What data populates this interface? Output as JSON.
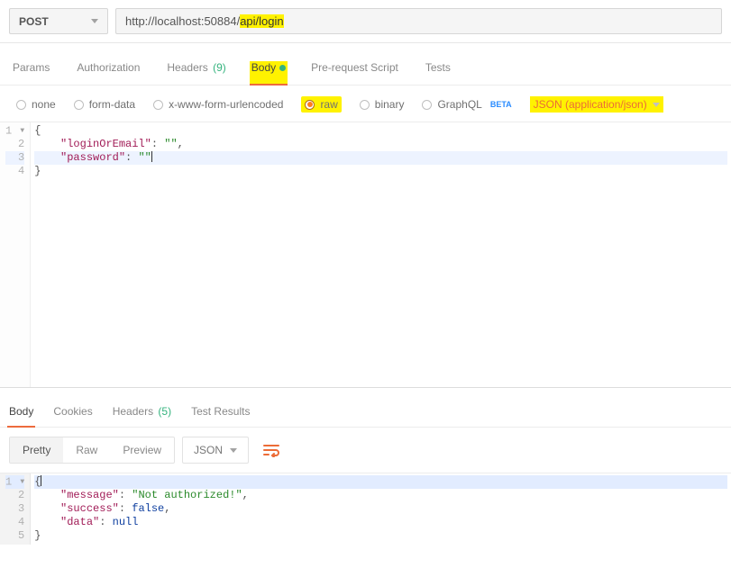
{
  "request": {
    "method": "POST",
    "url_plain": "http://localhost:50884/",
    "url_highlight": "api/login"
  },
  "tabs": {
    "params": "Params",
    "authorization": "Authorization",
    "headers_label": "Headers",
    "headers_count": "(9)",
    "body": "Body",
    "pre_request": "Pre-request Script",
    "tests": "Tests"
  },
  "body_types": {
    "none": "none",
    "form_data": "form-data",
    "urlencoded": "x-www-form-urlencoded",
    "raw": "raw",
    "binary": "binary",
    "graphql": "GraphQL",
    "graphql_beta": "BETA",
    "content_type": "JSON (application/json)"
  },
  "request_body": {
    "line1": "{",
    "line2_key": "\"loginOrEmail\"",
    "line2_val": "\"\"",
    "line3_key": "\"password\"",
    "line3_val": "\"\"",
    "line4": "}",
    "gutter": [
      "1",
      "2",
      "3",
      "4"
    ]
  },
  "response_tabs": {
    "body": "Body",
    "cookies": "Cookies",
    "headers_label": "Headers",
    "headers_count": "(5)",
    "test_results": "Test Results"
  },
  "response_toolbar": {
    "pretty": "Pretty",
    "raw": "Raw",
    "preview": "Preview",
    "lang": "JSON"
  },
  "response_body": {
    "line1": "{",
    "line2_key": "\"message\"",
    "line2_val": "\"Not authorized!\"",
    "line3_key": "\"success\"",
    "line3_val": "false",
    "line4_key": "\"data\"",
    "line4_val": "null",
    "line5": "}",
    "gutter": [
      "1",
      "2",
      "3",
      "4",
      "5"
    ]
  }
}
